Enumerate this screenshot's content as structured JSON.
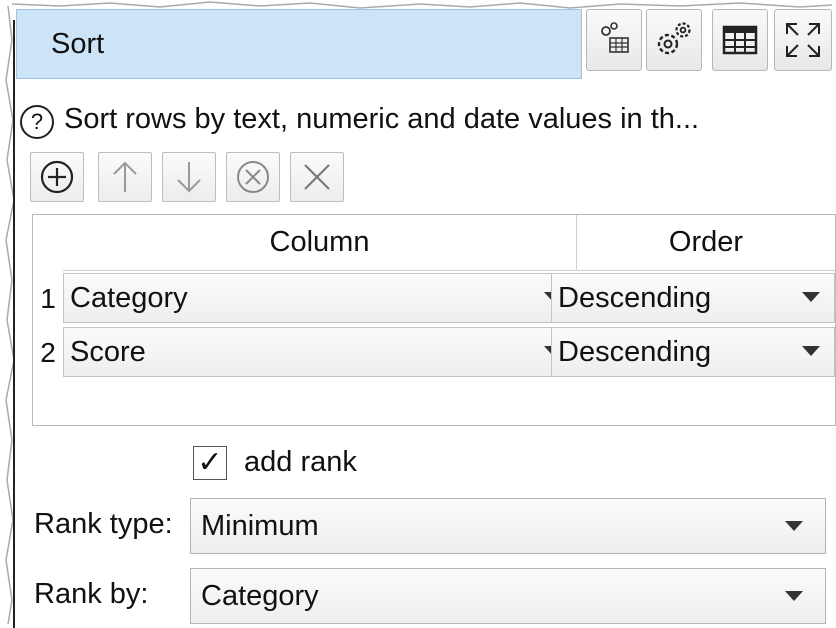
{
  "node": {
    "title": "Sort"
  },
  "toolbar": {
    "icons": [
      "node-properties-icon",
      "settings-icon",
      "table-view-icon",
      "expand-icon"
    ]
  },
  "help": {
    "text": "Sort rows by text, numeric and date values in th..."
  },
  "actions": {
    "icons": [
      "add-icon",
      "move-up-icon",
      "move-down-icon",
      "remove-icon",
      "clear-icon"
    ]
  },
  "grid": {
    "headers": {
      "column": "Column",
      "order": "Order"
    },
    "rows": [
      {
        "num": "1",
        "column": "Category",
        "order": "Descending"
      },
      {
        "num": "2",
        "column": "Score",
        "order": "Descending"
      }
    ]
  },
  "add_rank": {
    "checked": true,
    "mark": "✓",
    "label": "add rank"
  },
  "rank_type": {
    "label": "Rank type:",
    "value": "Minimum"
  },
  "rank_by": {
    "label": "Rank by:",
    "value": "Category"
  },
  "colors": {
    "title_bg": "#cde4f7",
    "title_border": "#9fc3e3"
  }
}
